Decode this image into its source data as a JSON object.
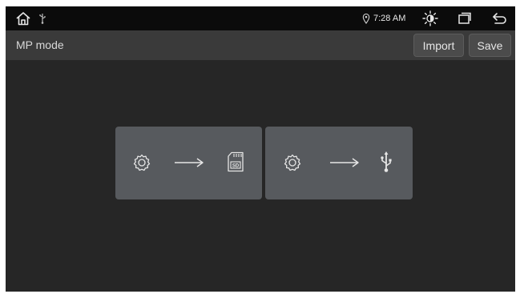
{
  "status_bar": {
    "time": "7:28 AM",
    "icons": [
      "home-icon",
      "usb-icon",
      "location-icon",
      "brightness-icon",
      "windows-icon",
      "back-icon"
    ]
  },
  "header": {
    "title": "MP mode",
    "import_label": "Import",
    "save_label": "Save"
  },
  "cards": [
    {
      "name": "settings-to-sd-card",
      "icons": [
        "settings-icon",
        "arrow-right-icon",
        "sd-card-icon"
      ],
      "sd_label": "SD"
    },
    {
      "name": "settings-to-usb",
      "icons": [
        "settings-icon",
        "arrow-right-icon",
        "usb-icon"
      ]
    }
  ],
  "colors": {
    "status_bar_bg": "#0b0b0b",
    "title_bar_bg": "#3a3a3a",
    "screen_bg": "#262626",
    "card_bg": "#575a5e",
    "icon": "#e6e6e6"
  }
}
